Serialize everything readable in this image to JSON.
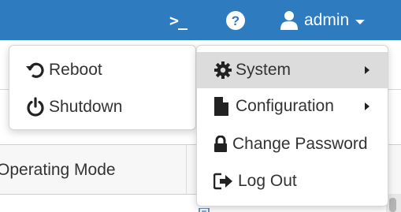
{
  "topbar": {
    "console_label": ">_",
    "user_name": "admin"
  },
  "submenu": {
    "items": [
      {
        "label": "Reboot",
        "icon": "reboot-icon"
      },
      {
        "label": "Shutdown",
        "icon": "power-icon"
      }
    ]
  },
  "menu": {
    "items": [
      {
        "label": "System",
        "icon": "gear-icon",
        "has_submenu": true,
        "active": true
      },
      {
        "label": "Configuration",
        "icon": "file-icon",
        "has_submenu": true
      },
      {
        "label": "Change Password",
        "icon": "lock-icon"
      },
      {
        "label": "Log Out",
        "icon": "sign-out-icon"
      }
    ]
  },
  "table": {
    "column_header": "Operating Mode"
  },
  "colors": {
    "topbar": "#2f7bbf",
    "active_item": "#dcdcdc",
    "text": "#333333"
  }
}
